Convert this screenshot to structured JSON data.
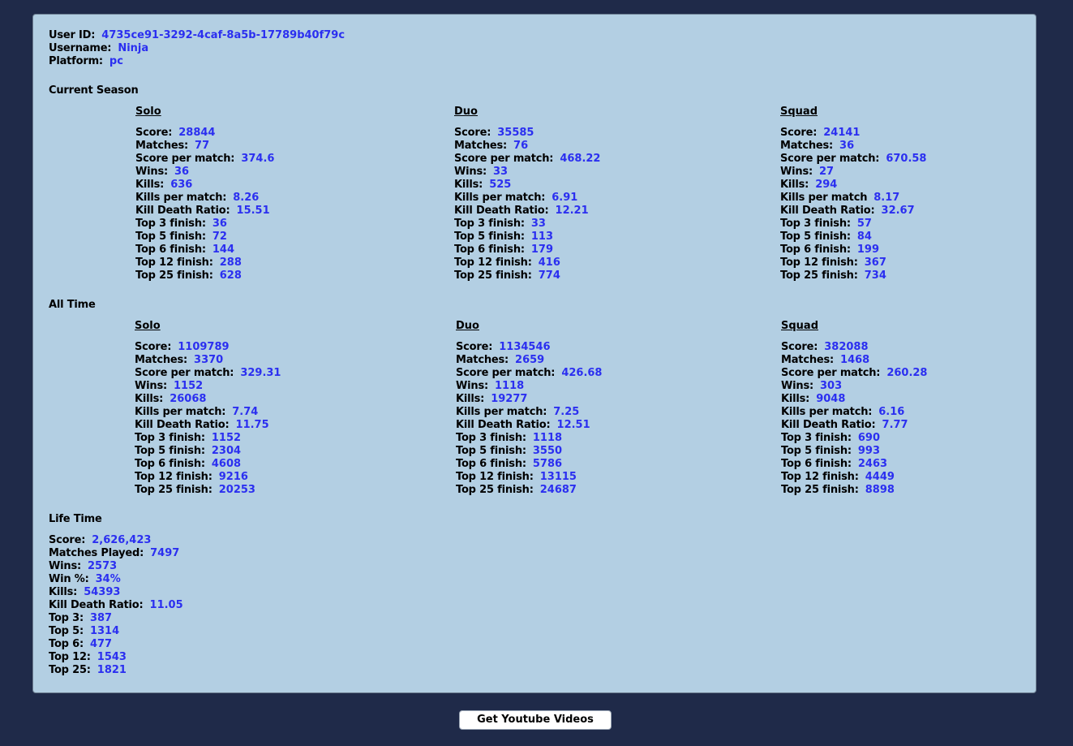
{
  "user": {
    "id_label": "User ID:",
    "id_value": "4735ce91-3292-4caf-8a5b-17789b40f79c",
    "username_label": "Username:",
    "username_value": "Ninja",
    "platform_label": "Platform:",
    "platform_value": "pc"
  },
  "current_season": {
    "title": "Current Season",
    "solo": {
      "title": "Solo",
      "stats": [
        {
          "label": "Score:",
          "value": "28844"
        },
        {
          "label": "Matches:",
          "value": "77"
        },
        {
          "label": "Score per match:",
          "value": "374.6"
        },
        {
          "label": "Wins:",
          "value": "36"
        },
        {
          "label": "Kills:",
          "value": "636"
        },
        {
          "label": "Kills per match:",
          "value": "8.26"
        },
        {
          "label": "Kill Death Ratio:",
          "value": "15.51"
        },
        {
          "label": "Top 3 finish:",
          "value": "36"
        },
        {
          "label": "Top 5 finish:",
          "value": "72"
        },
        {
          "label": "Top 6 finish:",
          "value": "144"
        },
        {
          "label": "Top 12 finish:",
          "value": "288"
        },
        {
          "label": "Top 25 finish:",
          "value": "628"
        }
      ]
    },
    "duo": {
      "title": "Duo",
      "stats": [
        {
          "label": "Score:",
          "value": "35585"
        },
        {
          "label": "Matches:",
          "value": "76"
        },
        {
          "label": "Score per match:",
          "value": "468.22"
        },
        {
          "label": "Wins:",
          "value": "33"
        },
        {
          "label": "Kills:",
          "value": "525"
        },
        {
          "label": "Kills per match:",
          "value": "6.91"
        },
        {
          "label": "Kill Death Ratio:",
          "value": "12.21"
        },
        {
          "label": "Top 3 finish:",
          "value": "33"
        },
        {
          "label": "Top 5 finish:",
          "value": "113"
        },
        {
          "label": "Top 6 finish:",
          "value": "179"
        },
        {
          "label": "Top 12 finish:",
          "value": "416"
        },
        {
          "label": "Top 25 finish:",
          "value": "774"
        }
      ]
    },
    "squad": {
      "title": "Squad",
      "stats": [
        {
          "label": "Score:",
          "value": "24141"
        },
        {
          "label": "Matches:",
          "value": "36"
        },
        {
          "label": "Score per match:",
          "value": "670.58"
        },
        {
          "label": "Wins:",
          "value": "27"
        },
        {
          "label": "Kills:",
          "value": "294"
        },
        {
          "label": "Kills per match",
          "value": "8.17"
        },
        {
          "label": "Kill Death Ratio:",
          "value": "32.67"
        },
        {
          "label": "Top 3 finish:",
          "value": "57"
        },
        {
          "label": "Top 5 finish:",
          "value": "84"
        },
        {
          "label": "Top 6 finish:",
          "value": "199"
        },
        {
          "label": "Top 12 finish:",
          "value": "367"
        },
        {
          "label": "Top 25 finish:",
          "value": "734"
        }
      ]
    }
  },
  "all_time": {
    "title": "All Time",
    "solo": {
      "title": "Solo",
      "stats": [
        {
          "label": "Score:",
          "value": "1109789"
        },
        {
          "label": "Matches:",
          "value": "3370"
        },
        {
          "label": "Score per match:",
          "value": "329.31"
        },
        {
          "label": "Wins:",
          "value": "1152"
        },
        {
          "label": "Kills:",
          "value": "26068"
        },
        {
          "label": "Kills per match:",
          "value": "7.74"
        },
        {
          "label": "Kill Death Ratio:",
          "value": "11.75"
        },
        {
          "label": "Top 3 finish:",
          "value": "1152"
        },
        {
          "label": "Top 5 finish:",
          "value": "2304"
        },
        {
          "label": "Top 6 finish:",
          "value": "4608"
        },
        {
          "label": "Top 12 finish:",
          "value": "9216"
        },
        {
          "label": "Top 25 finish:",
          "value": "20253"
        }
      ]
    },
    "duo": {
      "title": "Duo",
      "stats": [
        {
          "label": "Score:",
          "value": "1134546"
        },
        {
          "label": "Matches:",
          "value": "2659"
        },
        {
          "label": "Score per match:",
          "value": "426.68"
        },
        {
          "label": "Wins:",
          "value": "1118"
        },
        {
          "label": "Kills:",
          "value": "19277"
        },
        {
          "label": "Kills per match:",
          "value": "7.25"
        },
        {
          "label": "Kill Death Ratio:",
          "value": "12.51"
        },
        {
          "label": "Top 3 finish:",
          "value": "1118"
        },
        {
          "label": "Top 5 finish:",
          "value": "3550"
        },
        {
          "label": "Top 6 finish:",
          "value": "5786"
        },
        {
          "label": "Top 12 finish:",
          "value": "13115"
        },
        {
          "label": "Top 25 finish:",
          "value": "24687"
        }
      ]
    },
    "squad": {
      "title": "Squad",
      "stats": [
        {
          "label": "Score:",
          "value": "382088"
        },
        {
          "label": "Matches:",
          "value": "1468"
        },
        {
          "label": "Score per match:",
          "value": "260.28"
        },
        {
          "label": "Wins:",
          "value": "303"
        },
        {
          "label": "Kills:",
          "value": "9048"
        },
        {
          "label": "Kills per match:",
          "value": "6.16"
        },
        {
          "label": "Kill Death Ratio:",
          "value": "7.77"
        },
        {
          "label": "Top 3 finish:",
          "value": "690"
        },
        {
          "label": "Top 5 finish:",
          "value": "993"
        },
        {
          "label": "Top 6 finish:",
          "value": "2463"
        },
        {
          "label": "Top 12 finish:",
          "value": "4449"
        },
        {
          "label": "Top 25 finish:",
          "value": "8898"
        }
      ]
    }
  },
  "life_time": {
    "title": "Life Time",
    "stats": [
      {
        "label": "Score:",
        "value": "2,626,423"
      },
      {
        "label": "Matches Played:",
        "value": "7497"
      },
      {
        "label": "Wins:",
        "value": "2573"
      },
      {
        "label": "Win %:",
        "value": "34%"
      },
      {
        "label": "Kills:",
        "value": "54393"
      },
      {
        "label": "Kill Death Ratio:",
        "value": "11.05"
      },
      {
        "label": "Top 3:",
        "value": "387"
      },
      {
        "label": "Top 5:",
        "value": "1314"
      },
      {
        "label": "Top 6:",
        "value": "477"
      },
      {
        "label": "Top 12:",
        "value": "1543"
      },
      {
        "label": "Top 25:",
        "value": "1821"
      }
    ]
  },
  "youtube_button": {
    "label": "Get Youtube Videos"
  },
  "colors": {
    "background": "#1f2a49",
    "panel": "#b3cfe3",
    "value_text": "#2b2ff0"
  }
}
